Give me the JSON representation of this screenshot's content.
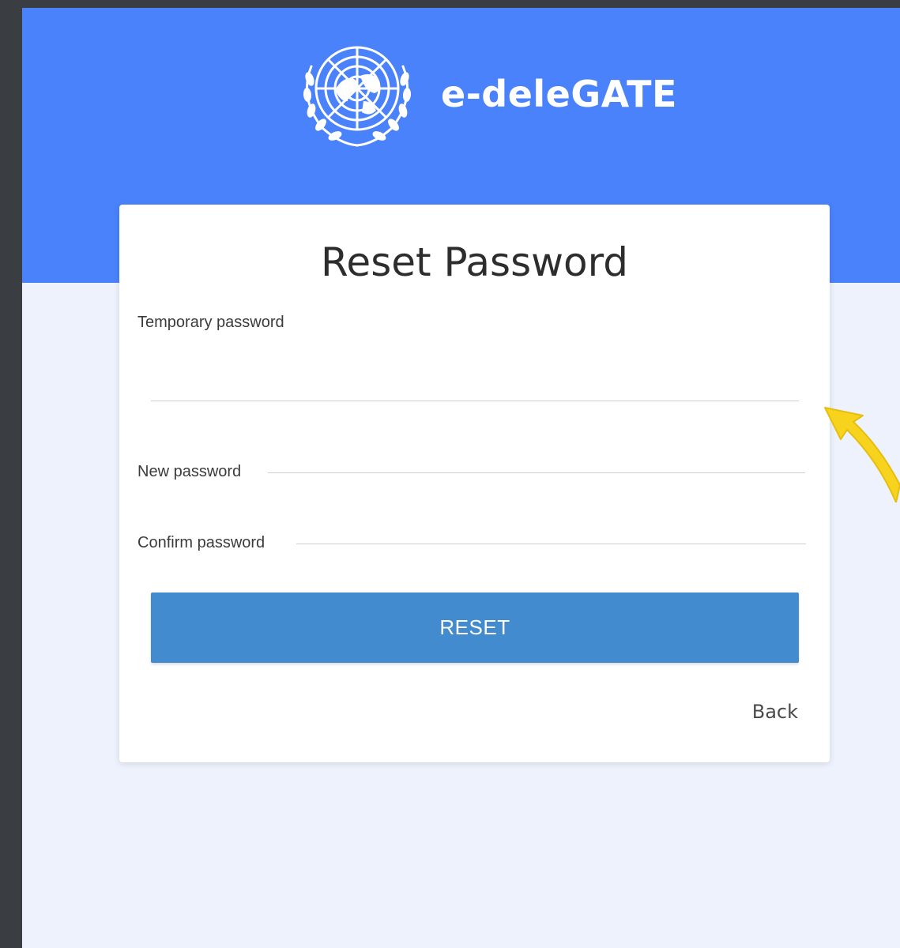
{
  "brand": {
    "name": "e-deleGATE",
    "logo_icon": "un-emblem-icon"
  },
  "form": {
    "title": "Reset Password",
    "temporary_password": {
      "label": "Temporary password",
      "value": ""
    },
    "new_password": {
      "label": "New password",
      "value": ""
    },
    "confirm_password": {
      "label": "Confirm password",
      "value": ""
    },
    "reset_label": "RESET",
    "back_label": "Back"
  },
  "colors": {
    "header_blue": "#4a82fb",
    "button_blue": "#428bcf",
    "page_background": "#eef2fc",
    "annotation_yellow": "#f7d31e"
  }
}
